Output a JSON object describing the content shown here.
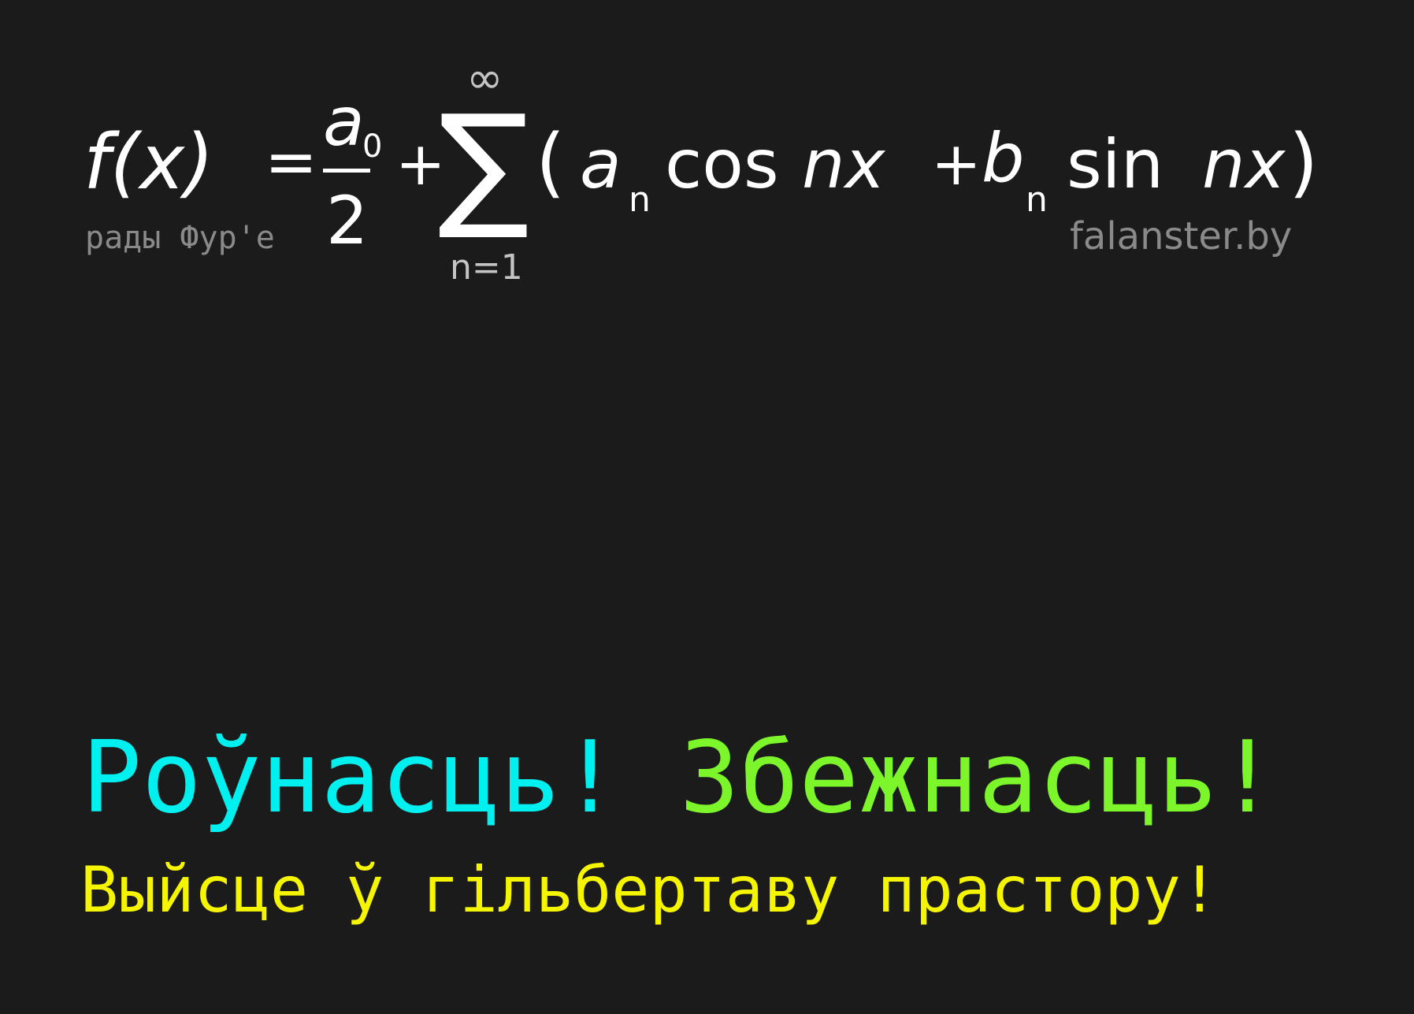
{
  "formula": {
    "lhs": "f(x)",
    "equals": "=",
    "a0_base": "a",
    "a0_sub": "0",
    "denominator": "2",
    "plus1": "+",
    "sigma": "∑",
    "upper_limit": "∞",
    "lower_limit": "n=1",
    "open_paren": "(",
    "an_base": "a",
    "an_sub": "n",
    "cos": "cos",
    "nx1": "nx",
    "plus2": "+",
    "bn_base": "b",
    "bn_sub": "n",
    "sin": "sin",
    "nx2": "nx",
    "close_paren": ")"
  },
  "caption_left": "рады Фур'е",
  "caption_right": "falanster.by",
  "slogan": {
    "part1": "Роўнасць!",
    "part2": "Збежнасць!",
    "line2": "Выйсце ў гільбертаву прастору!"
  },
  "colors": {
    "background": "#1b1b1b",
    "formula": "#ffffff",
    "caption": "#8a8a8a",
    "part1": "#00f0f0",
    "part2": "#7cf52a",
    "line2": "#f5f500"
  }
}
